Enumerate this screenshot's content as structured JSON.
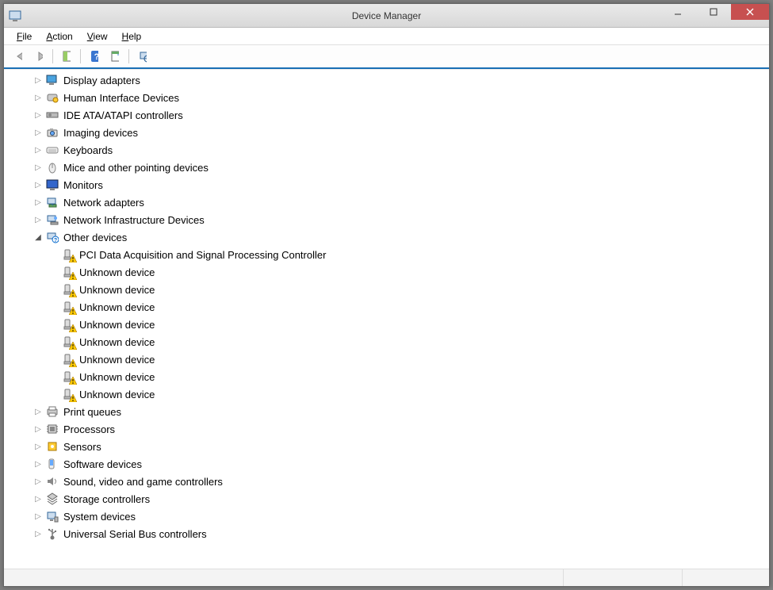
{
  "window": {
    "title": "Device Manager"
  },
  "menus": {
    "file": "File",
    "action": "Action",
    "view": "View",
    "help": "Help"
  },
  "toolbar": {
    "back": "Back",
    "forward": "Forward",
    "show_hide": "Show/Hide Console Tree",
    "help": "Help",
    "properties": "Properties",
    "scan": "Scan for hardware changes"
  },
  "tree": [
    {
      "label": "Display adapters",
      "icon": "display",
      "expanded": false,
      "level": 1
    },
    {
      "label": "Human Interface Devices",
      "icon": "hid",
      "expanded": false,
      "level": 1
    },
    {
      "label": "IDE ATA/ATAPI controllers",
      "icon": "ide",
      "expanded": false,
      "level": 1
    },
    {
      "label": "Imaging devices",
      "icon": "imaging",
      "expanded": false,
      "level": 1
    },
    {
      "label": "Keyboards",
      "icon": "keyboard",
      "expanded": false,
      "level": 1
    },
    {
      "label": "Mice and other pointing devices",
      "icon": "mouse",
      "expanded": false,
      "level": 1
    },
    {
      "label": "Monitors",
      "icon": "monitor",
      "expanded": false,
      "level": 1
    },
    {
      "label": "Network adapters",
      "icon": "network",
      "expanded": false,
      "level": 1
    },
    {
      "label": "Network Infrastructure Devices",
      "icon": "netinfra",
      "expanded": false,
      "level": 1
    },
    {
      "label": "Other devices",
      "icon": "other",
      "expanded": true,
      "level": 1,
      "children": [
        {
          "label": "PCI Data Acquisition and Signal Processing Controller",
          "icon": "warn",
          "level": 2
        },
        {
          "label": "Unknown device",
          "icon": "warn",
          "level": 2
        },
        {
          "label": "Unknown device",
          "icon": "warn",
          "level": 2
        },
        {
          "label": "Unknown device",
          "icon": "warn",
          "level": 2
        },
        {
          "label": "Unknown device",
          "icon": "warn",
          "level": 2
        },
        {
          "label": "Unknown device",
          "icon": "warn",
          "level": 2
        },
        {
          "label": "Unknown device",
          "icon": "warn",
          "level": 2
        },
        {
          "label": "Unknown device",
          "icon": "warn",
          "level": 2
        },
        {
          "label": "Unknown device",
          "icon": "warn",
          "level": 2
        }
      ]
    },
    {
      "label": "Print queues",
      "icon": "printer",
      "expanded": false,
      "level": 1
    },
    {
      "label": "Processors",
      "icon": "cpu",
      "expanded": false,
      "level": 1
    },
    {
      "label": "Sensors",
      "icon": "sensor",
      "expanded": false,
      "level": 1
    },
    {
      "label": "Software devices",
      "icon": "software",
      "expanded": false,
      "level": 1
    },
    {
      "label": "Sound, video and game controllers",
      "icon": "sound",
      "expanded": false,
      "level": 1
    },
    {
      "label": "Storage controllers",
      "icon": "storage",
      "expanded": false,
      "level": 1
    },
    {
      "label": "System devices",
      "icon": "system",
      "expanded": false,
      "level": 1
    },
    {
      "label": "Universal Serial Bus controllers",
      "icon": "usb",
      "expanded": false,
      "level": 1
    }
  ]
}
